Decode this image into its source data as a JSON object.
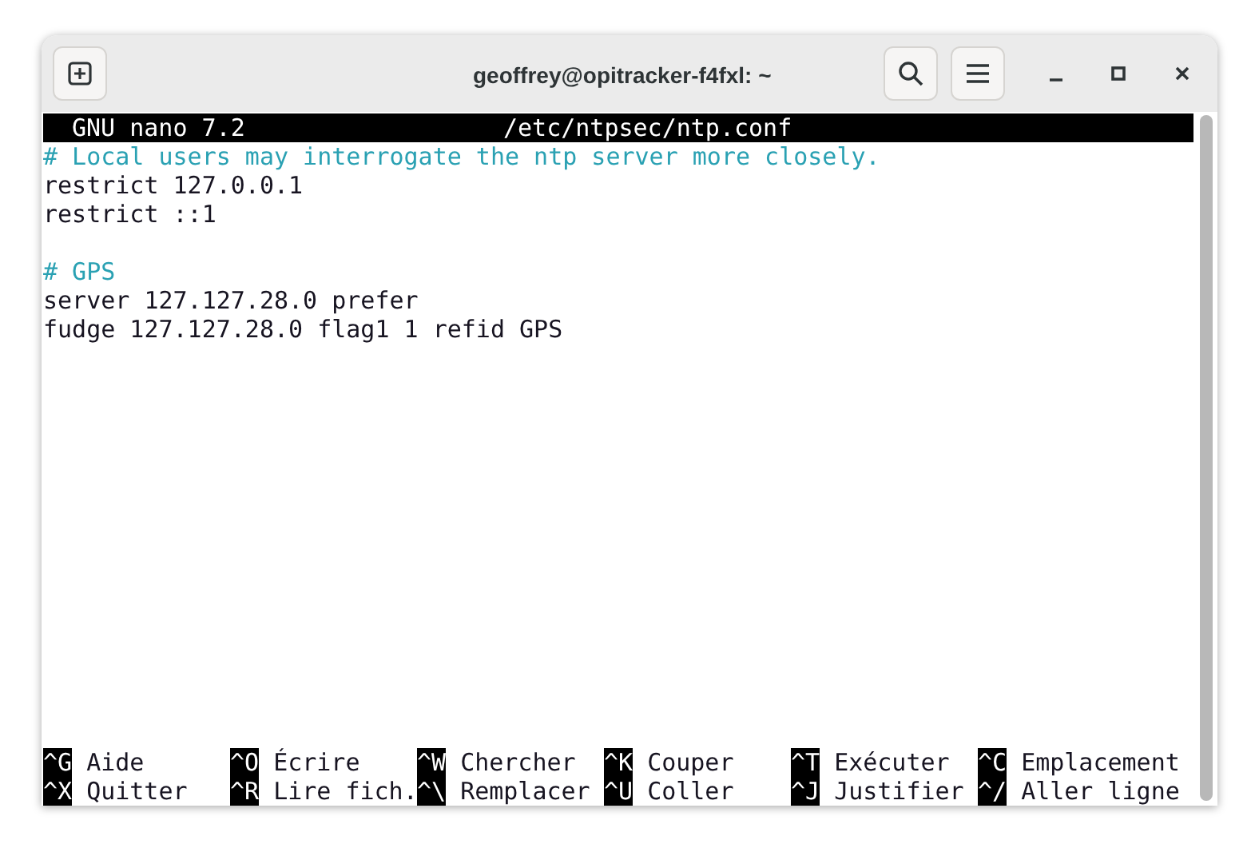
{
  "window": {
    "title": "geoffrey@opitracker-f4fxl: ~"
  },
  "header": {
    "app": "GNU nano 7.2",
    "filename": "/etc/ntpsec/ntp.conf"
  },
  "lines": [
    {
      "kind": "comment",
      "text": "# Local users may interrogate the ntp server more closely."
    },
    {
      "kind": "code",
      "text": "restrict 127.0.0.1"
    },
    {
      "kind": "code",
      "text": "restrict ::1"
    },
    {
      "kind": "blank"
    },
    {
      "kind": "comment",
      "text": "# GPS"
    },
    {
      "kind": "code",
      "text": "server 127.127.28.0 prefer"
    },
    {
      "kind": "code",
      "text": "fudge 127.127.28.0 flag1 1 refid GPS"
    }
  ],
  "shortcuts": [
    [
      {
        "key": "^G",
        "label": "Aide"
      },
      {
        "key": "^O",
        "label": "Écrire"
      },
      {
        "key": "^W",
        "label": "Chercher"
      },
      {
        "key": "^K",
        "label": "Couper"
      },
      {
        "key": "^T",
        "label": "Exécuter"
      },
      {
        "key": "^C",
        "label": "Emplacement"
      }
    ],
    [
      {
        "key": "^X",
        "label": "Quitter"
      },
      {
        "key": "^R",
        "label": "Lire fich."
      },
      {
        "key": "^\\",
        "label": "Remplacer"
      },
      {
        "key": "^U",
        "label": "Coller"
      },
      {
        "key": "^J",
        "label": "Justifier"
      },
      {
        "key": "^/",
        "label": "Aller ligne"
      }
    ]
  ]
}
